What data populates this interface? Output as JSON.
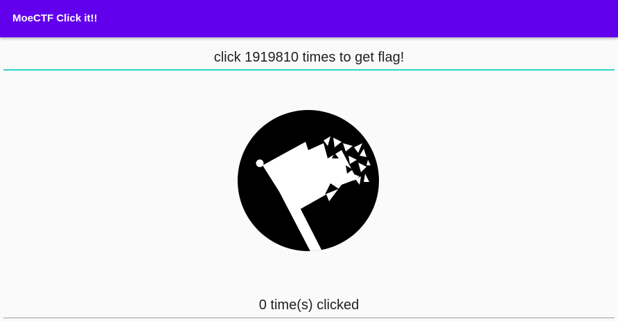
{
  "app_bar": {
    "title": "MoeCTF Click it!!",
    "color": "#6200ee"
  },
  "prompt": {
    "text": "click 1919810 times to get flag!",
    "underline_color": "#2ed3c6"
  },
  "flag_button": {
    "icon": "flag-icon"
  },
  "counter": {
    "text": "0 time(s) clicked"
  }
}
